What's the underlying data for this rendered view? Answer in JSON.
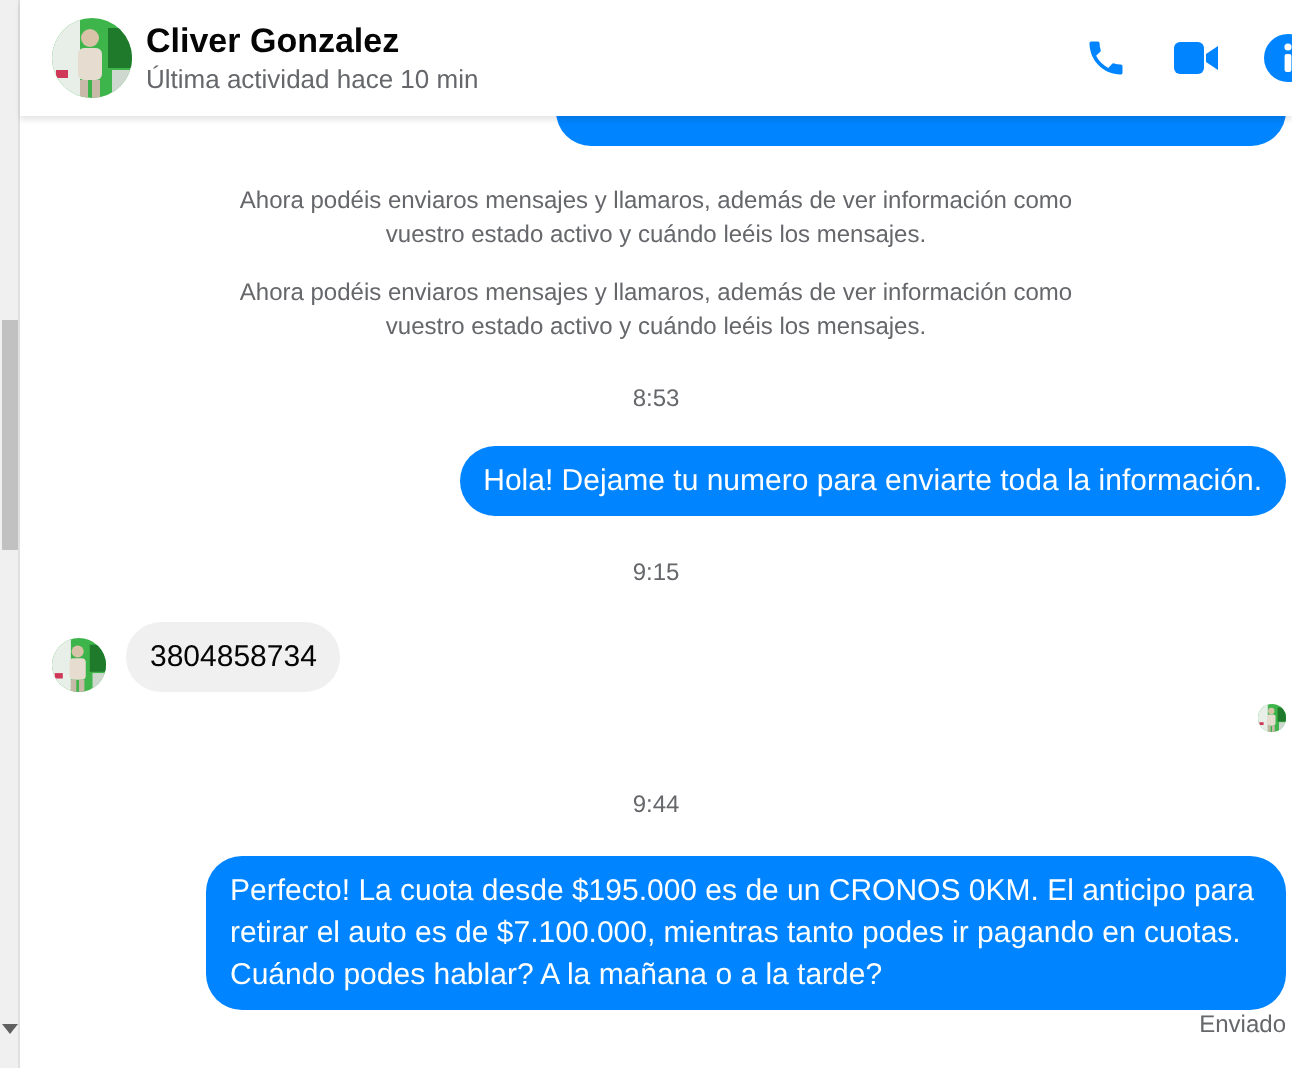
{
  "header": {
    "name": "Cliver Gonzalez",
    "status": "Última actividad hace 10 min"
  },
  "messages": [
    {
      "kind": "clipped"
    },
    {
      "kind": "notice",
      "text": "Ahora podéis enviaros mensajes y llamaros, además de ver información como vuestro estado activo y cuándo leéis los mensajes."
    },
    {
      "kind": "notice",
      "text": "Ahora podéis enviaros mensajes y llamaros, además de ver información como vuestro estado activo y cuándo leéis los mensajes."
    },
    {
      "kind": "time",
      "text": "8:53"
    },
    {
      "kind": "sent",
      "text": "Hola! Dejame tu numero  para enviarte toda la información."
    },
    {
      "kind": "time",
      "text": "9:15"
    },
    {
      "kind": "received",
      "text": "3804858734"
    },
    {
      "kind": "seen"
    },
    {
      "kind": "time",
      "text": "9:44"
    },
    {
      "kind": "sent",
      "text": "Perfecto! La cuota desde $195.000 es de un CRONOS 0KM. El anticipo para retirar el auto es de $7.100.000, mientras tanto podes ir pagando en cuotas. Cuándo podes hablar? A la mañana o a la tarde?"
    },
    {
      "kind": "status",
      "text": "Enviado"
    }
  ]
}
